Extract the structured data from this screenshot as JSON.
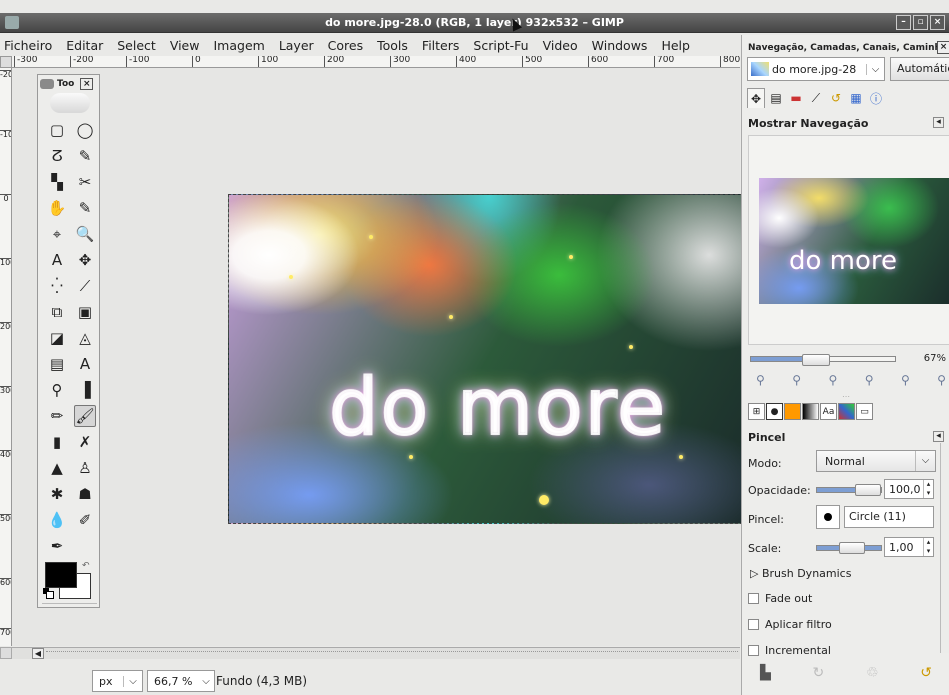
{
  "window": {
    "title": "do more.jpg-28.0 (RGB, 1 layer) 932x532 – GIMP",
    "buttons": [
      "–",
      "▫",
      "×"
    ]
  },
  "menubar": [
    "Ficheiro",
    "Editar",
    "Select",
    "View",
    "Imagem",
    "Layer",
    "Cores",
    "Tools",
    "Filters",
    "Script-Fu",
    "Video",
    "Windows",
    "Help"
  ],
  "hruler": [
    "-300",
    "-200",
    "-100",
    "0",
    "100",
    "200",
    "300",
    "400",
    "500",
    "600",
    "700",
    "800"
  ],
  "vruler": [
    "-200",
    "-100",
    "0",
    "100",
    "200",
    "300",
    "400",
    "500",
    "600",
    "700"
  ],
  "canvas": {
    "image_text": "do more"
  },
  "statusbar": {
    "unit": "px",
    "zoom": "66,7 %",
    "layer_info": "Fundo (4,3 MB)"
  },
  "toolbox": {
    "title": "Too",
    "tools": [
      "▢",
      "◯",
      "ⵒ",
      "✎",
      "▚",
      "✂",
      "✋",
      "✎",
      "⌖",
      "🔍",
      "A",
      "✥",
      "⁛",
      "⟋",
      "⧉",
      "▣",
      "◪",
      "◬",
      "▤",
      "A",
      "⚲",
      "▐",
      "✏",
      "🖌",
      "▮",
      "✗",
      "▲",
      "♙",
      "✱",
      "☗",
      "💧",
      "✐",
      "✒"
    ]
  },
  "dock": {
    "title": "Navegação, Camadas, Canais, Caminhos",
    "image_select": "do more.jpg-28",
    "auto_button": "Automático",
    "nav_heading": "Mostrar Navegação",
    "nav_thumb_text": "do more",
    "zoom_percent": "67%",
    "zoom_fraction": 0.45,
    "pincel_heading": "Pincel",
    "modo_label": "Modo:",
    "modo_value": "Normal",
    "opacidade_label": "Opacidade:",
    "opacidade_value": "100,0",
    "pincel_label": "Pincel:",
    "pincel_value": "Circle (11)",
    "scale_label": "Scale:",
    "scale_value": "1,00",
    "brush_dynamics": "Brush Dynamics",
    "fade_out": "Fade out",
    "aplicar_filtro": "Aplicar filtro",
    "incremental": "Incremental"
  }
}
